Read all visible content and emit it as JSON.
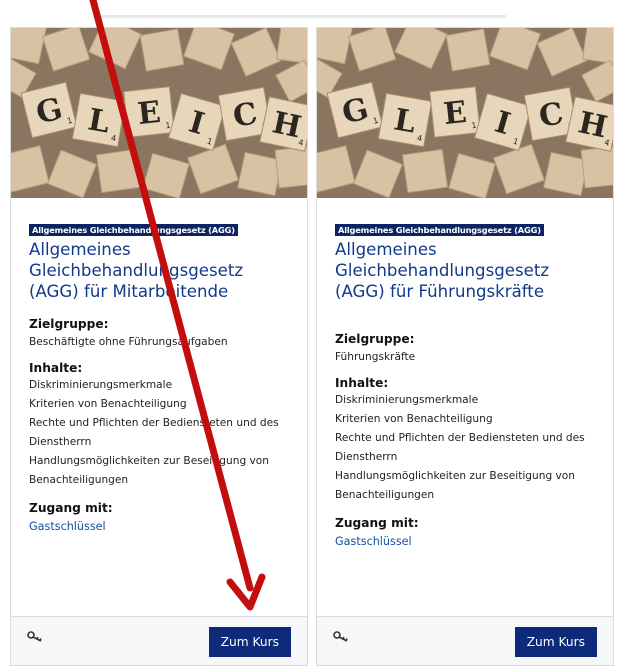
{
  "colors": {
    "badge_bg": "#0c2461",
    "title": "#113a8c",
    "button_bg": "#0e2a7a",
    "annotation_arrow": "#c40d0d"
  },
  "cards": [
    {
      "image_letters": [
        "G",
        "L",
        "E",
        "I",
        "C",
        "H"
      ],
      "image_subscripts": [
        "1",
        "4",
        "1",
        "1",
        "3",
        "4"
      ],
      "badge": "Allgemeines Gleichbehandlungsgesetz (AGG)",
      "title": "Allgemeines Gleichbehandlungsgesetz (AGG) für Mitarbeitende",
      "zielgruppe_label": "Zielgruppe:",
      "zielgruppe": "Beschäftigte ohne Führungsaufgaben",
      "inhalte_label": "Inhalte:",
      "inhalte": [
        "Diskriminierungsmerkmale",
        "Kriterien von Benachteiligung",
        "Rechte und Pflichten der Bediensteten und des Dienstherrn",
        "Handlungsmöglichkeiten zur Beseitigung von Benachteiligungen"
      ],
      "zugang_label": "Zugang mit:",
      "zugang_link": "Gastschlüssel",
      "footer_icon": "key-icon",
      "button": "Zum Kurs"
    },
    {
      "image_letters": [
        "G",
        "L",
        "E",
        "I",
        "C",
        "H"
      ],
      "image_subscripts": [
        "1",
        "4",
        "1",
        "1",
        "3",
        "4"
      ],
      "badge": "Allgemeines Gleichbehandlungsgesetz (AGG)",
      "title": "Allgemeines Gleichbehandlungsgesetz (AGG) für Führungskräfte",
      "zielgruppe_label": "Zielgruppe:",
      "zielgruppe": "Führungskräfte",
      "inhalte_label": "Inhalte:",
      "inhalte": [
        "Diskriminierungsmerkmale",
        "Kriterien von Benachteiligung",
        "Rechte und Pflichten der Bediensteten und des Dienstherrn",
        "Handlungsmöglichkeiten zur Beseitigung von Benachteiligungen"
      ],
      "zugang_label": "Zugang mit:",
      "zugang_link": "Gastschlüssel",
      "footer_icon": "key-icon",
      "button": "Zum Kurs"
    }
  ]
}
